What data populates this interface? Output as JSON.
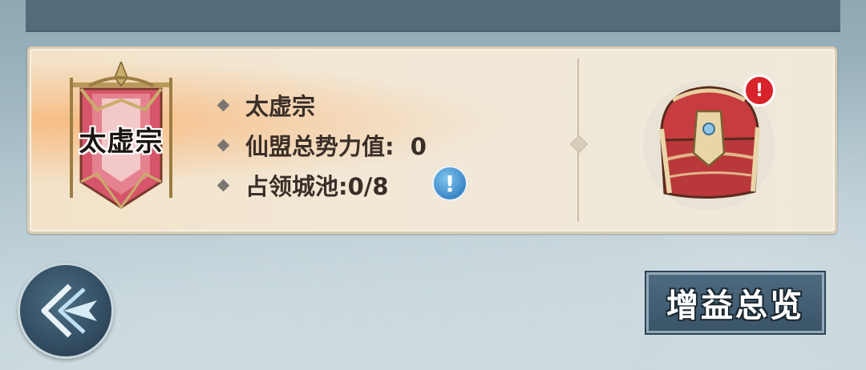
{
  "sect": {
    "name_banner": "太虚宗",
    "info": [
      {
        "text": "太虚宗"
      },
      {
        "text": "仙盟总势力值:  0"
      },
      {
        "text": "占领城池:0/8"
      }
    ]
  },
  "info_icon_label": "!",
  "chest_badge_label": "!",
  "buff_button_label": "增益总览",
  "colors": {
    "panel_bg": "#efe9dc",
    "accent_banner": "#c9485a",
    "alert_red": "#d8232b",
    "info_blue": "#3b86c6"
  },
  "icons": {
    "banner": "sect-banner-icon",
    "chest": "treasure-chest-icon",
    "back": "back-arrow-icon"
  }
}
